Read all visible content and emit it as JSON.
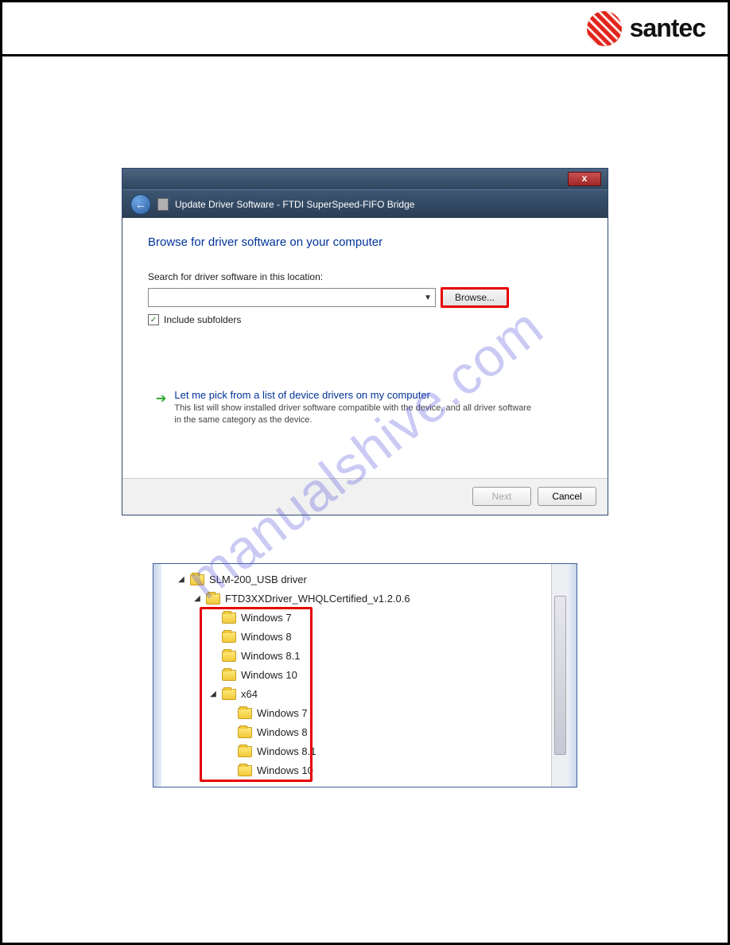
{
  "brand": {
    "name": "santec"
  },
  "watermark": "manualshive.com",
  "dialog": {
    "title": "Update Driver Software - FTDI SuperSpeed-FIFO Bridge",
    "close_glyph": "x",
    "heading": "Browse for driver software on your computer",
    "search_label": "Search for driver software in this location:",
    "browse_label": "Browse...",
    "include_subfolders_label": "Include subfolders",
    "include_subfolders_checked": "✓",
    "pick_title": "Let me pick from a list of device drivers on my computer",
    "pick_desc": "This list will show installed driver software compatible with the device, and all driver software in the same category as the device.",
    "next_label": "Next",
    "cancel_label": "Cancel"
  },
  "tree": {
    "root": "SLM-200_USB driver",
    "sub": "FTD3XXDriver_WHQLCertified_v1.2.0.6",
    "items_top": [
      "Windows 7",
      "Windows 8",
      "Windows 8.1",
      "Windows 10"
    ],
    "x64_label": "x64",
    "items_x64": [
      "Windows 7",
      "Windows 8",
      "Windows 8.1",
      "Windows 10"
    ]
  }
}
